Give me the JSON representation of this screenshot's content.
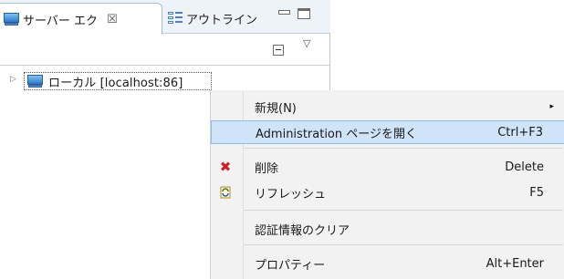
{
  "tabs": {
    "servers": {
      "label": "サーバー エク",
      "close": "☒",
      "icon": "server-icon"
    },
    "outline": {
      "label": "アウトライン",
      "icon": "outline-icon"
    }
  },
  "view_controls": {
    "minimize": "minimize-icon",
    "maximize": "maximize-icon",
    "collapse_all": "collapse-all-icon",
    "view_menu": "▽"
  },
  "tree": {
    "expand_glyph": "▷",
    "node_label": "ローカル [localhost:86]",
    "icon": "server-icon"
  },
  "context_menu": {
    "items": [
      {
        "label": "新規(N)",
        "accelerator": "",
        "has_submenu": true
      },
      {
        "label": "Administration ページを開く",
        "accelerator": "Ctrl+F3",
        "highlighted": true
      },
      {
        "label": "削除",
        "accelerator": "Delete",
        "icon": "delete-icon"
      },
      {
        "label": "リフレッシュ",
        "accelerator": "F5",
        "icon": "refresh-icon"
      },
      {
        "label": "認証情報のクリア",
        "accelerator": ""
      },
      {
        "label": "プロパティー",
        "accelerator": "Alt+Enter"
      }
    ],
    "submenu_arrow": "▸",
    "delete_glyph": "✖"
  },
  "colors": {
    "highlight": "#cfe4f8",
    "menu_bg": "#f2f2f2",
    "tab_bar": "#eef3f9",
    "delete_red": "#cc2222"
  }
}
